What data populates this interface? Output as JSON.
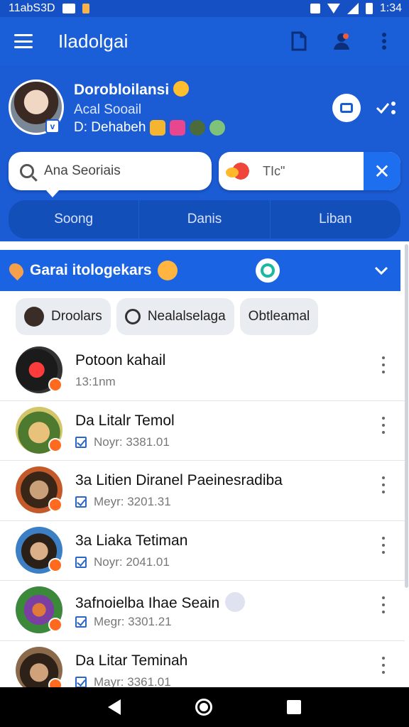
{
  "status_bar": {
    "time_left": "11abS3D",
    "time_right": "1:34"
  },
  "app_bar": {
    "title": "Iladolgai"
  },
  "profile": {
    "name": "Dorobloilansi",
    "subtitle": "Acal Sooail",
    "meta": "D: Dehabeh"
  },
  "search": {
    "placeholder": "Ana Seoriais"
  },
  "tag_filter": {
    "text": "TIc\""
  },
  "segments": [
    "Soong",
    "Danis",
    "Liban"
  ],
  "section": {
    "title": "Garai itologekars"
  },
  "chips": [
    "Droolars",
    "Nealalselaga",
    "Obtleamal"
  ],
  "list": [
    {
      "title": "Potoon kahail",
      "sub": "13:1nm",
      "checked": false
    },
    {
      "title": "Da Litalr Temol",
      "sub": "Noyr: 3381.01",
      "checked": true
    },
    {
      "title": "3a Litien Diranel Paeinesradiba",
      "sub": "Meyr: 3201.31",
      "checked": true
    },
    {
      "title": "3a Liaka Tetiman",
      "sub": "Noyr: 2041.01",
      "checked": true
    },
    {
      "title": "3afnoielba Ihae Seain",
      "sub": "Megr: 3301.21",
      "checked": true
    },
    {
      "title": "Da Litar Teminah",
      "sub": "Mayr: 3361.01",
      "checked": true
    }
  ]
}
